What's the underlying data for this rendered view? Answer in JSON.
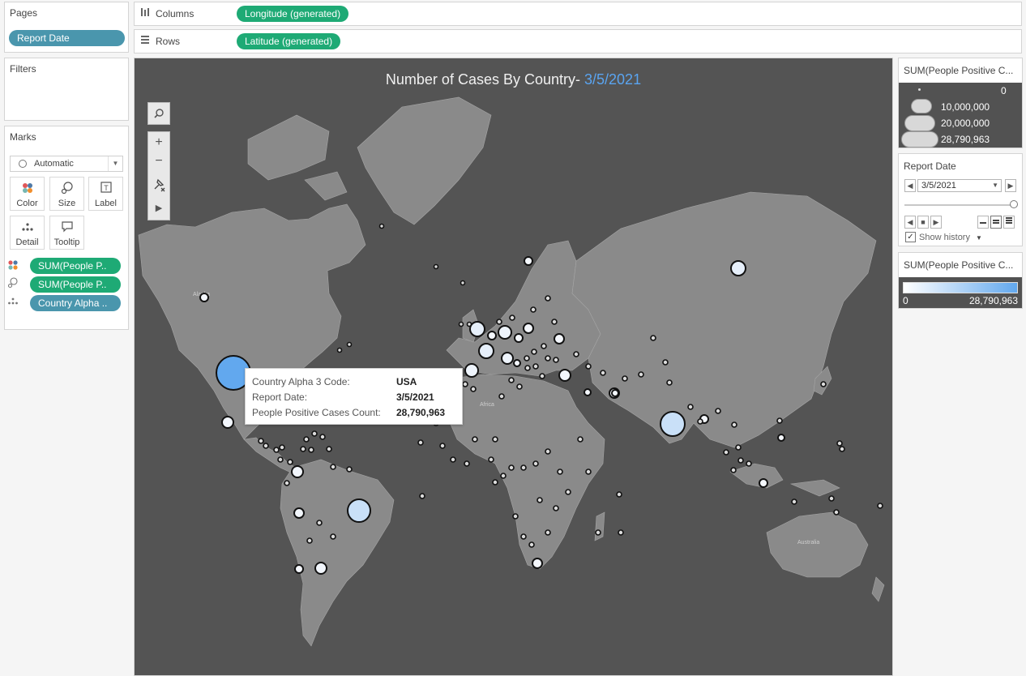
{
  "pages": {
    "title": "Pages",
    "pill": "Report Date"
  },
  "filters": {
    "title": "Filters"
  },
  "marks": {
    "title": "Marks",
    "mark_type": "Automatic",
    "buttons": {
      "color": "Color",
      "size": "Size",
      "label": "Label",
      "detail": "Detail",
      "tooltip": "Tooltip"
    },
    "fields": [
      "SUM(People P..",
      "SUM(People P..",
      "Country Alpha .."
    ]
  },
  "shelves": {
    "columns_label": "Columns",
    "columns_pill": "Longitude (generated)",
    "rows_label": "Rows",
    "rows_pill": "Latitude (generated)"
  },
  "map": {
    "title": "Number of Cases By Country-",
    "title_date": "3/5/2021",
    "colors": {
      "background": "#545454",
      "land": "#8a8a8a",
      "highlight": "#62a8ee",
      "low": "#ffffff"
    },
    "place_labels": [
      "Alaska",
      "Africa",
      "Australia"
    ]
  },
  "tooltip": {
    "rows": [
      {
        "key": "Country Alpha 3 Code:",
        "value": "USA"
      },
      {
        "key": "Report Date:",
        "value": "3/5/2021"
      },
      {
        "key": "People Positive Cases Count:",
        "value": "28,790,963"
      }
    ]
  },
  "size_legend": {
    "title": "SUM(People Positive C...",
    "entries": [
      "0",
      "10,000,000",
      "20,000,000",
      "28,790,963"
    ]
  },
  "page_control": {
    "title": "Report Date",
    "value": "3/5/2021",
    "show_history": "Show history"
  },
  "color_legend": {
    "title": "SUM(People Positive C...",
    "min": "0",
    "max": "28,790,963"
  }
}
